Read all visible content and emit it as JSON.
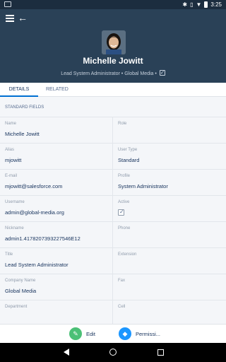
{
  "status_bar": {
    "time": "3:25",
    "bluetooth_icon": "bluetooth-icon",
    "vibrate_icon": "vibrate-icon",
    "signal_icon": "signal-icon",
    "battery_icon": "battery-icon"
  },
  "header": {
    "name": "Michelle Jowitt",
    "subtitle": "Lead System Administrator • Global Media •",
    "active_checked": true,
    "colors": {
      "bg": "#2a4157"
    }
  },
  "tabs": [
    {
      "label": "DETAILS",
      "active": true
    },
    {
      "label": "RELATED",
      "active": false
    }
  ],
  "section": {
    "title": "STANDARD FIELDS"
  },
  "fields": [
    {
      "left_label": "Name",
      "left_value": "Michelle Jowitt",
      "right_label": "Role",
      "right_value": ""
    },
    {
      "left_label": "Alias",
      "left_value": "mjowitt",
      "right_label": "User Type",
      "right_value": "Standard"
    },
    {
      "left_label": "E-mail",
      "left_value": "mjowitt@salesforce.com",
      "right_label": "Profile",
      "right_value": "System Administrator"
    },
    {
      "left_label": "Username",
      "left_value": "admin@global-media.org",
      "right_label": "Active",
      "right_value": ""
    },
    {
      "left_label": "Nickname",
      "left_value": "admin1.4178207393227546E12",
      "right_label": "Phone",
      "right_value": ""
    },
    {
      "left_label": "Title",
      "left_value": "Lead System Administrator",
      "right_label": "Extension",
      "right_value": ""
    },
    {
      "left_label": "Company Name",
      "left_value": "Global Media",
      "right_label": "Fax",
      "right_value": ""
    },
    {
      "left_label": "Department",
      "left_value": "",
      "right_label": "Cell",
      "right_value": ""
    }
  ],
  "actions": [
    {
      "label": "Edit",
      "icon": "pencil-icon",
      "color": "#4bc076"
    },
    {
      "label": "Permissi...",
      "icon": "cube-icon",
      "color": "#1b96ff"
    }
  ],
  "nav_bar": {
    "back_icon": "back-icon",
    "home_icon": "home-icon",
    "recents_icon": "recents-icon"
  }
}
